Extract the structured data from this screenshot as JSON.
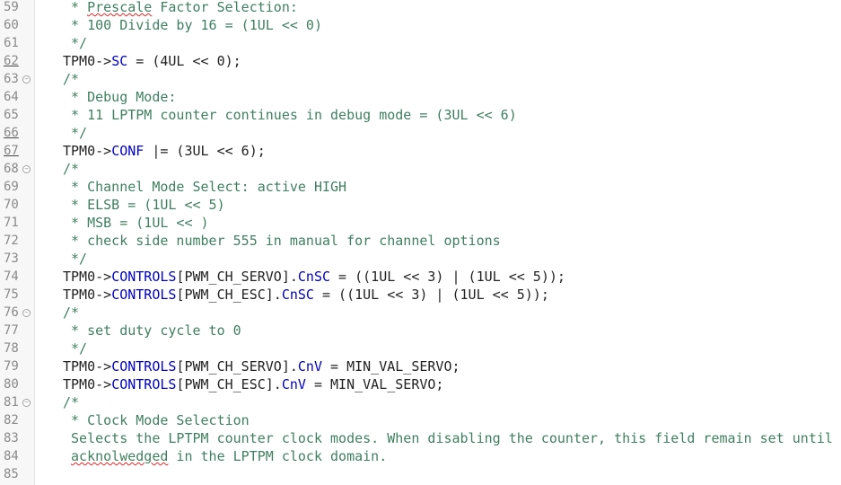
{
  "editor": {
    "lines": [
      {
        "n": "59",
        "fold": false,
        "ul": false,
        "segs": [
          {
            "t": " * ",
            "c": "cmt"
          },
          {
            "t": "Prescale",
            "c": "cmt wavy"
          },
          {
            "t": " Factor Selection:",
            "c": "cmt"
          }
        ]
      },
      {
        "n": "60",
        "fold": false,
        "ul": false,
        "segs": [
          {
            "t": " * 100 Divide by 16 = (1UL << 0)",
            "c": "cmt"
          }
        ]
      },
      {
        "n": "61",
        "fold": false,
        "ul": false,
        "segs": [
          {
            "t": " */",
            "c": "cmt"
          }
        ]
      },
      {
        "n": "62",
        "fold": false,
        "ul": true,
        "segs": [
          {
            "t": "TPM0->",
            "c": "txt"
          },
          {
            "t": "SC",
            "c": "fld"
          },
          {
            "t": " = (4UL << 0);",
            "c": "txt"
          }
        ]
      },
      {
        "n": "63",
        "fold": true,
        "ul": false,
        "segs": [
          {
            "t": "/*",
            "c": "cmt"
          }
        ]
      },
      {
        "n": "64",
        "fold": false,
        "ul": false,
        "segs": [
          {
            "t": " * Debug Mode:",
            "c": "cmt"
          }
        ]
      },
      {
        "n": "65",
        "fold": false,
        "ul": false,
        "segs": [
          {
            "t": " * 11 LPTPM counter continues in debug mode = (3UL << 6)",
            "c": "cmt"
          }
        ]
      },
      {
        "n": "66",
        "fold": false,
        "ul": true,
        "segs": [
          {
            "t": " */",
            "c": "cmt"
          }
        ]
      },
      {
        "n": "67",
        "fold": false,
        "ul": true,
        "segs": [
          {
            "t": "TPM0->",
            "c": "txt"
          },
          {
            "t": "CONF",
            "c": "fld"
          },
          {
            "t": " |= (3UL << 6);",
            "c": "txt"
          }
        ]
      },
      {
        "n": "68",
        "fold": true,
        "ul": false,
        "segs": [
          {
            "t": "/*",
            "c": "cmt"
          }
        ]
      },
      {
        "n": "69",
        "fold": false,
        "ul": false,
        "segs": [
          {
            "t": " * Channel Mode Select: active HIGH",
            "c": "cmt"
          }
        ]
      },
      {
        "n": "70",
        "fold": false,
        "ul": false,
        "segs": [
          {
            "t": " * ELSB = (1UL << 5)",
            "c": "cmt"
          }
        ]
      },
      {
        "n": "71",
        "fold": false,
        "ul": false,
        "segs": [
          {
            "t": " * MSB = (1UL << )",
            "c": "cmt"
          }
        ]
      },
      {
        "n": "72",
        "fold": false,
        "ul": false,
        "segs": [
          {
            "t": " * check side number 555 in manual for channel options",
            "c": "cmt"
          }
        ]
      },
      {
        "n": "73",
        "fold": false,
        "ul": false,
        "segs": [
          {
            "t": " */",
            "c": "cmt"
          }
        ]
      },
      {
        "n": "74",
        "fold": false,
        "ul": false,
        "segs": [
          {
            "t": "TPM0->",
            "c": "txt"
          },
          {
            "t": "CONTROLS",
            "c": "fld"
          },
          {
            "t": "[PWM_CH_SERVO].",
            "c": "txt"
          },
          {
            "t": "CnSC",
            "c": "fld"
          },
          {
            "t": " = ((1UL << 3) | (1UL << 5));",
            "c": "txt"
          }
        ]
      },
      {
        "n": "75",
        "fold": false,
        "ul": false,
        "segs": [
          {
            "t": "TPM0->",
            "c": "txt"
          },
          {
            "t": "CONTROLS",
            "c": "fld"
          },
          {
            "t": "[PWM_CH_ESC].",
            "c": "txt"
          },
          {
            "t": "CnSC",
            "c": "fld"
          },
          {
            "t": " = ((1UL << 3) | (1UL << 5));",
            "c": "txt"
          }
        ]
      },
      {
        "n": "76",
        "fold": true,
        "ul": false,
        "segs": [
          {
            "t": "/*",
            "c": "cmt"
          }
        ]
      },
      {
        "n": "77",
        "fold": false,
        "ul": false,
        "segs": [
          {
            "t": " * set duty cycle to 0",
            "c": "cmt"
          }
        ]
      },
      {
        "n": "78",
        "fold": false,
        "ul": false,
        "segs": [
          {
            "t": " */",
            "c": "cmt"
          }
        ]
      },
      {
        "n": "79",
        "fold": false,
        "ul": false,
        "segs": [
          {
            "t": "TPM0->",
            "c": "txt"
          },
          {
            "t": "CONTROLS",
            "c": "fld"
          },
          {
            "t": "[PWM_CH_SERVO].",
            "c": "txt"
          },
          {
            "t": "CnV",
            "c": "fld"
          },
          {
            "t": " = MIN_VAL_SERVO;",
            "c": "txt"
          }
        ]
      },
      {
        "n": "80",
        "fold": false,
        "ul": false,
        "segs": [
          {
            "t": "TPM0->",
            "c": "txt"
          },
          {
            "t": "CONTROLS",
            "c": "fld"
          },
          {
            "t": "[PWM_CH_ESC].",
            "c": "txt"
          },
          {
            "t": "CnV",
            "c": "fld"
          },
          {
            "t": " = MIN_VAL_SERVO;",
            "c": "txt"
          }
        ]
      },
      {
        "n": "81",
        "fold": true,
        "ul": false,
        "segs": [
          {
            "t": "/*",
            "c": "cmt"
          }
        ]
      },
      {
        "n": "82",
        "fold": false,
        "ul": false,
        "segs": [
          {
            "t": " * Clock Mode Selection",
            "c": "cmt"
          }
        ]
      },
      {
        "n": "83",
        "fold": false,
        "ul": false,
        "segs": [
          {
            "t": " Selects the LPTPM counter clock modes. When disabling the counter, this field remain set until",
            "c": "cmt"
          }
        ]
      },
      {
        "n": "84",
        "fold": false,
        "ul": false,
        "segs": [
          {
            "t": " ",
            "c": "cmt"
          },
          {
            "t": "acknolwedged",
            "c": "cmt wavy"
          },
          {
            "t": " in the LPTPM clock domain.",
            "c": "cmt"
          }
        ]
      },
      {
        "n": "85",
        "fold": false,
        "ul": false,
        "segs": []
      }
    ]
  }
}
